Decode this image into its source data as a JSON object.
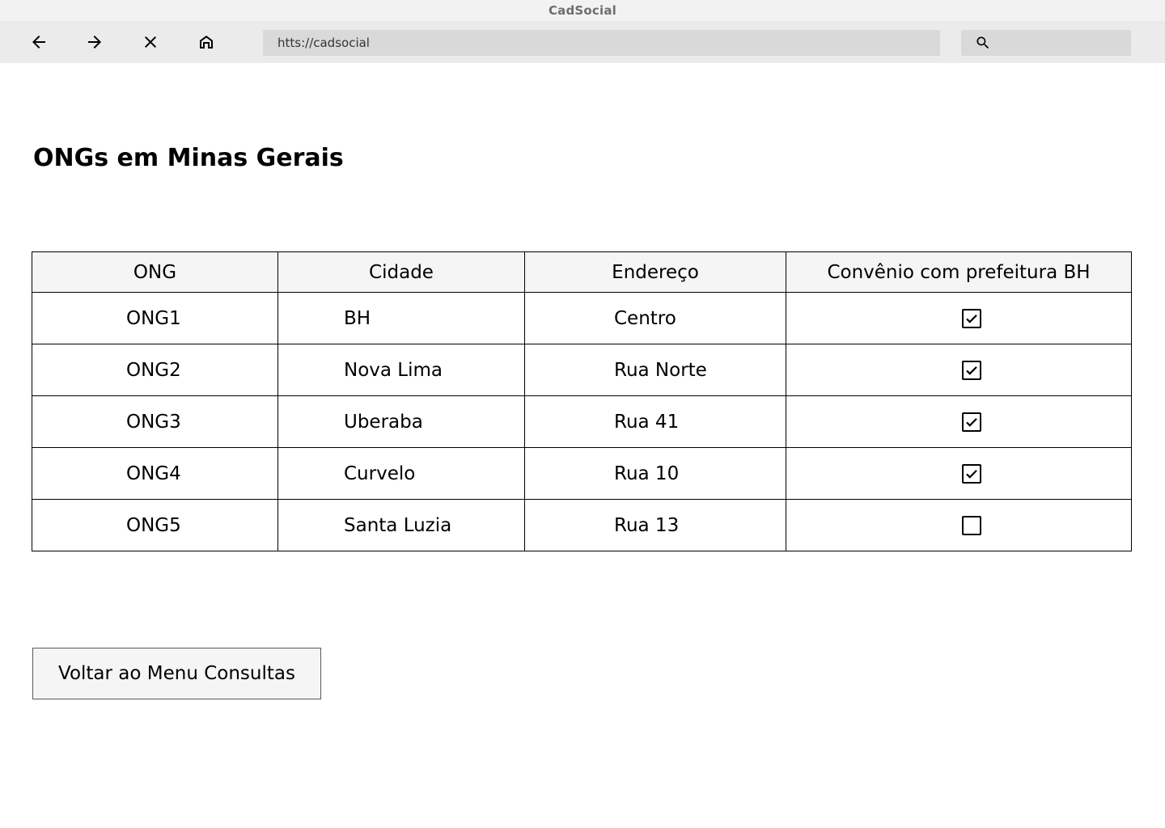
{
  "window": {
    "title": "CadSocial"
  },
  "toolbar": {
    "back_icon": "arrow-left-icon",
    "forward_icon": "arrow-right-icon",
    "stop_icon": "close-icon",
    "home_icon": "home-icon",
    "url": "htts://cadsocial",
    "search_icon": "search-icon"
  },
  "main": {
    "title": "ONGs em Minas Gerais",
    "table": {
      "headers": [
        "ONG",
        "Cidade",
        "Endereço",
        "Convênio com prefeitura BH"
      ],
      "rows": [
        {
          "ong": "ONG1",
          "cidade": "BH",
          "endereco": "Centro",
          "convenio": true
        },
        {
          "ong": "ONG2",
          "cidade": "Nova Lima",
          "endereco": "Rua Norte",
          "convenio": true
        },
        {
          "ong": "ONG3",
          "cidade": "Uberaba",
          "endereco": "Rua 41",
          "convenio": true
        },
        {
          "ong": "ONG4",
          "cidade": "Curvelo",
          "endereco": "Rua 10",
          "convenio": true
        },
        {
          "ong": "ONG5",
          "cidade": "Santa Luzia",
          "endereco": "Rua 13",
          "convenio": false
        }
      ]
    },
    "back_button_label": "Voltar ao Menu Consultas"
  }
}
